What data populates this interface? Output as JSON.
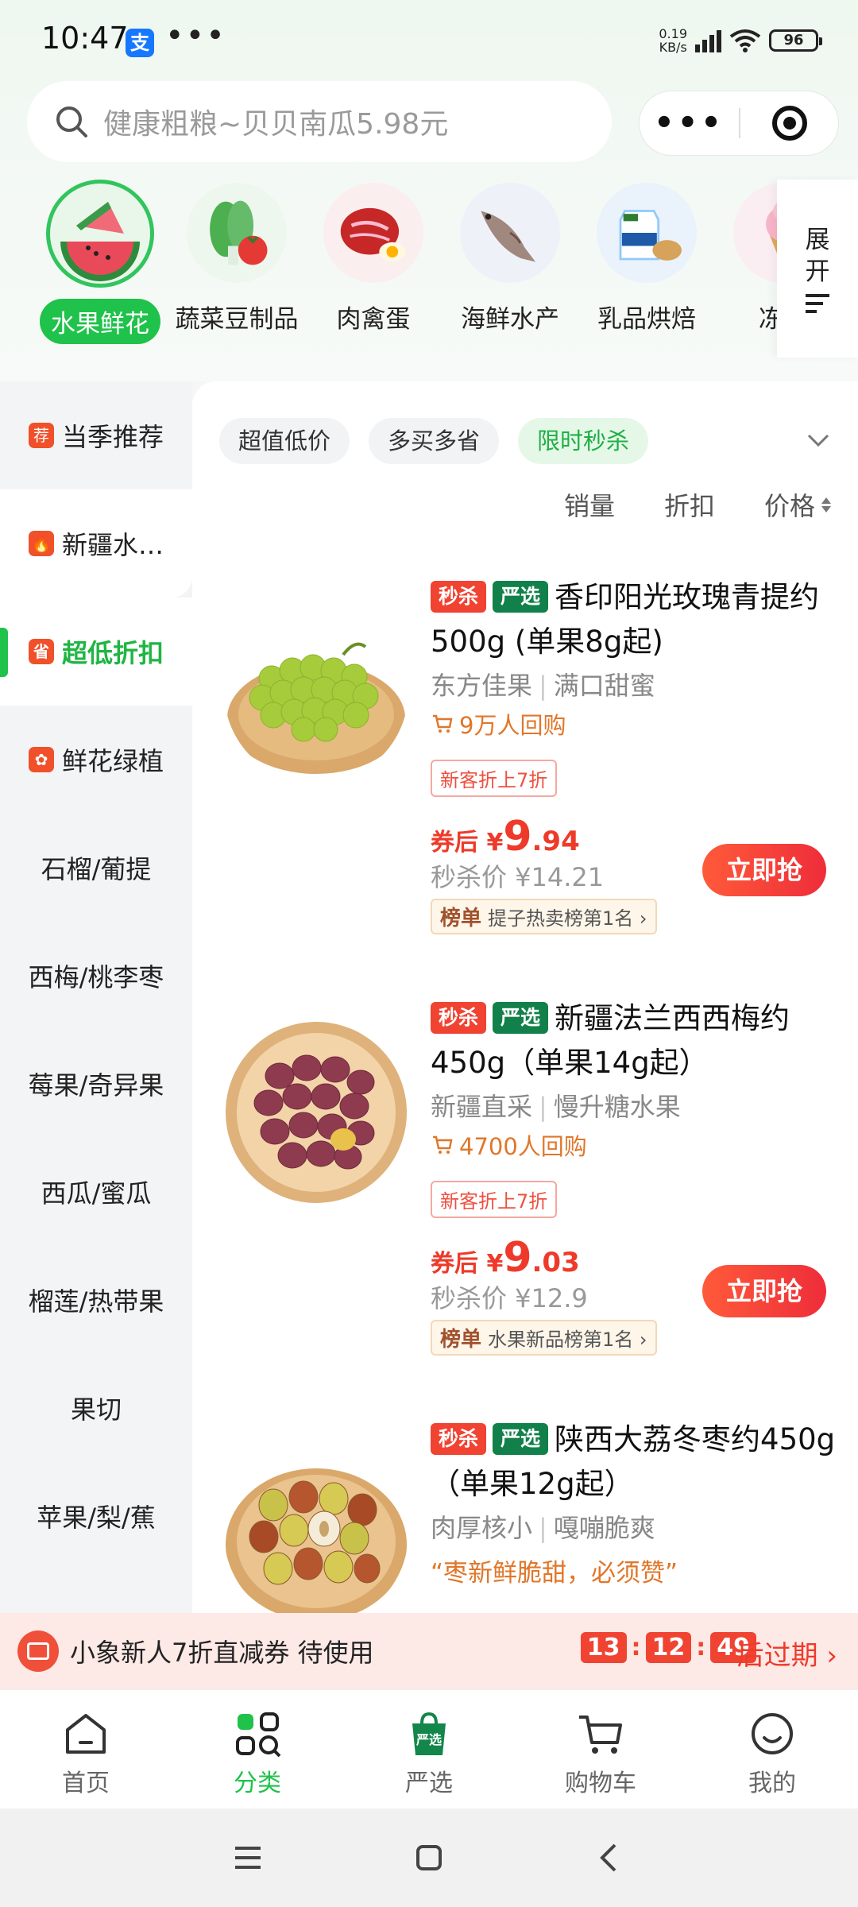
{
  "status": {
    "time": "10:47",
    "alipay": "支",
    "dots": "•••",
    "speed_top": "0.19",
    "speed_bottom": "KB/s",
    "battery": "96"
  },
  "search": {
    "placeholder": "健康粗粮~贝贝南瓜5.98元"
  },
  "categories": [
    {
      "label": "水果鲜花",
      "icon": "watermelon-icon",
      "active": true
    },
    {
      "label": "蔬菜豆制品",
      "icon": "vegetable-icon"
    },
    {
      "label": "肉禽蛋",
      "icon": "meat-icon"
    },
    {
      "label": "海鲜水产",
      "icon": "fish-icon"
    },
    {
      "label": "乳品烘焙",
      "icon": "milk-icon"
    },
    {
      "label": "冻品",
      "icon": "icecream-icon"
    }
  ],
  "expand_label_1": "展",
  "expand_label_2": "开",
  "sidebar": {
    "items": [
      {
        "label": "当季推荐",
        "tag": "荐"
      },
      {
        "label": "新疆水…",
        "tag": "🔥"
      },
      {
        "label": "超低折扣",
        "tag": "省",
        "active": true
      },
      {
        "label": "鲜花绿植",
        "tag": "✿"
      },
      {
        "label": "石榴/葡提"
      },
      {
        "label": "西梅/桃李枣"
      },
      {
        "label": "莓果/奇异果"
      },
      {
        "label": "西瓜/蜜瓜"
      },
      {
        "label": "榴莲/热带果"
      },
      {
        "label": "果切"
      },
      {
        "label": "苹果/梨/蕉"
      }
    ]
  },
  "filters": {
    "chips": [
      "超值低价",
      "多买多省",
      "限时秒杀"
    ],
    "active_chip": 2
  },
  "sort": {
    "sales": "销量",
    "discount": "折扣",
    "price": "价格"
  },
  "products": [
    {
      "badge1": "秒杀",
      "badge2": "严选",
      "title": "香印阳光玫瑰青提约500g (单果8g起)",
      "sub_a": "东方佳果",
      "sub_b": "满口甜蜜",
      "buyers": "9万人回购",
      "coupon": "新客折上7折",
      "price_prefix": "券后 ¥",
      "price_int": "9",
      "price_dec": ".94",
      "orig": "秒杀价 ¥14.21",
      "rank_tag": "榜单",
      "rank_text": "提子热卖榜第1名 ›",
      "button": "立即抢"
    },
    {
      "badge1": "秒杀",
      "badge2": "严选",
      "title": "新疆法兰西西梅约450g（单果14g起）",
      "sub_a": "新疆直采",
      "sub_b": "慢升糖水果",
      "buyers": "4700人回购",
      "coupon": "新客折上7折",
      "price_prefix": "券后 ¥",
      "price_int": "9",
      "price_dec": ".03",
      "orig": "秒杀价 ¥12.9",
      "rank_tag": "榜单",
      "rank_text": "水果新品榜第1名 ›",
      "button": "立即抢"
    },
    {
      "badge1": "秒杀",
      "badge2": "严选",
      "title": "陕西大荔冬枣约450g（单果12g起）",
      "sub_a": "肉厚核小",
      "sub_b": "嘎嘣脆爽",
      "quote": "“枣新鲜脆甜，必须赞”"
    }
  ],
  "coupon_bar": {
    "text": "小象新人7折直减券 待使用",
    "h": "13",
    "m": "12",
    "s": "49",
    "expire": "后过期 ›"
  },
  "tabs": [
    {
      "label": "首页",
      "icon": "home-icon"
    },
    {
      "label": "分类",
      "icon": "category-icon",
      "active": true
    },
    {
      "label": "严选",
      "icon": "yanxuan-bag-icon"
    },
    {
      "label": "购物车",
      "icon": "cart-icon"
    },
    {
      "label": "我的",
      "icon": "profile-icon"
    }
  ],
  "colors": {
    "accent": "#1fc24a",
    "price": "#ee3a2a",
    "flash": "#f04332",
    "brand_green": "#12804a"
  }
}
